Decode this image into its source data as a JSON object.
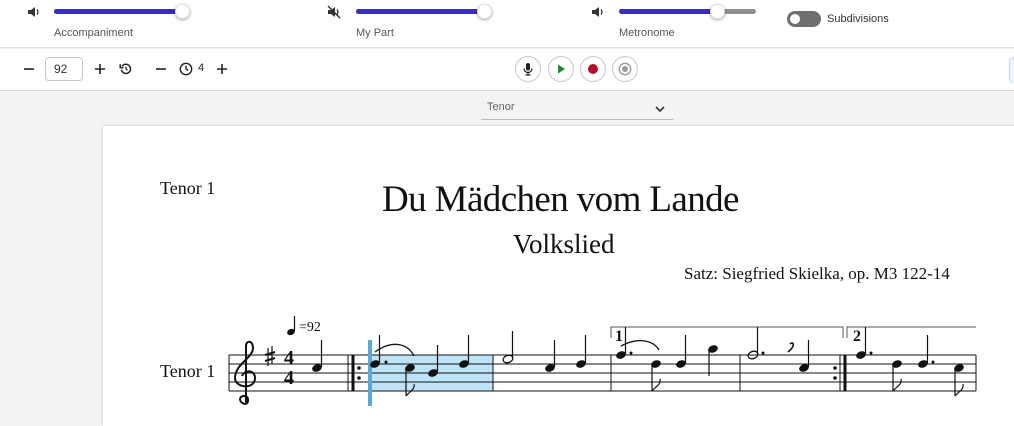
{
  "mixer": {
    "channels": [
      {
        "name": "Accompaniment",
        "muted": false,
        "level": 1.0
      },
      {
        "name": "My Part",
        "muted": true,
        "level": 1.0
      },
      {
        "name": "Metronome",
        "muted": false,
        "level": 0.72
      }
    ],
    "subdivisions_label": "Subdivisions",
    "subdivisions_on": false,
    "accent_color": "#3a2fb9"
  },
  "controls": {
    "tempo_value": "92",
    "count_in": "4",
    "icons": [
      "minus-icon",
      "plus-icon",
      "reset-icon",
      "clock-icon",
      "microphone-icon",
      "play-icon",
      "record-icon",
      "listen-icon"
    ]
  },
  "part_select": {
    "selected": "Tenor"
  },
  "score": {
    "part_name_top": "Tenor 1",
    "title": "Du Mädchen vom Lande",
    "subtitle": "Volkslied",
    "composer": "Satz: Siegfried Skielka, op. M3 122-14",
    "staff_label": "Tenor 1",
    "tempo_mark": "=92",
    "ending_1": "1",
    "ending_2": "2",
    "time_signature": {
      "top": "4",
      "bottom": "4"
    },
    "highlight_color": "#bfe3f7",
    "cursor_color": "#5aa9d6"
  }
}
